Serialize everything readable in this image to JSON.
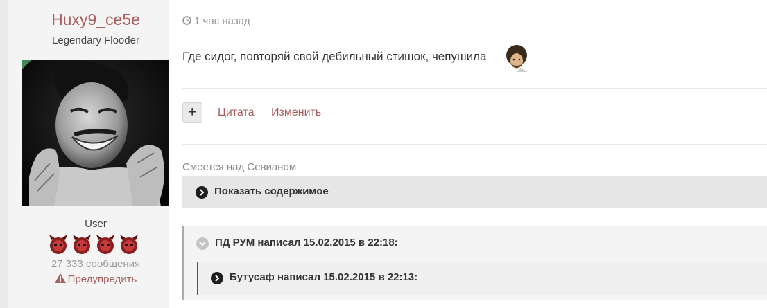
{
  "author": {
    "name": "Huxy9_ce5e",
    "title": "Legendary Flooder",
    "group": "User",
    "post_count": "27 333 сообщения",
    "warn_label": "Предупредить"
  },
  "post": {
    "time": "1 час назад",
    "text": "Где сидог, повторяй свой дебильный стишок, чепушила",
    "actions": {
      "quote": "Цитата",
      "edit": "Изменить"
    }
  },
  "spoiler": {
    "title": "Смеется над Севианом",
    "toggle_label": "Показать содержимое"
  },
  "quotes": [
    {
      "header": "ПД РУМ написал 15.02.2015 в 22:18:"
    },
    {
      "header": "Бутусаф написал 15.02.2015 в 22:13:"
    }
  ],
  "icons": {
    "clock": "clock-icon",
    "warn": "warning-triangle-icon",
    "plus": "plus-icon",
    "expand": "chevron-right-circle-icon",
    "collapse": "chevron-down-circle-icon"
  },
  "colors": {
    "accent": "#a95e5e",
    "muted": "#999999",
    "online": "#3f8a58"
  }
}
